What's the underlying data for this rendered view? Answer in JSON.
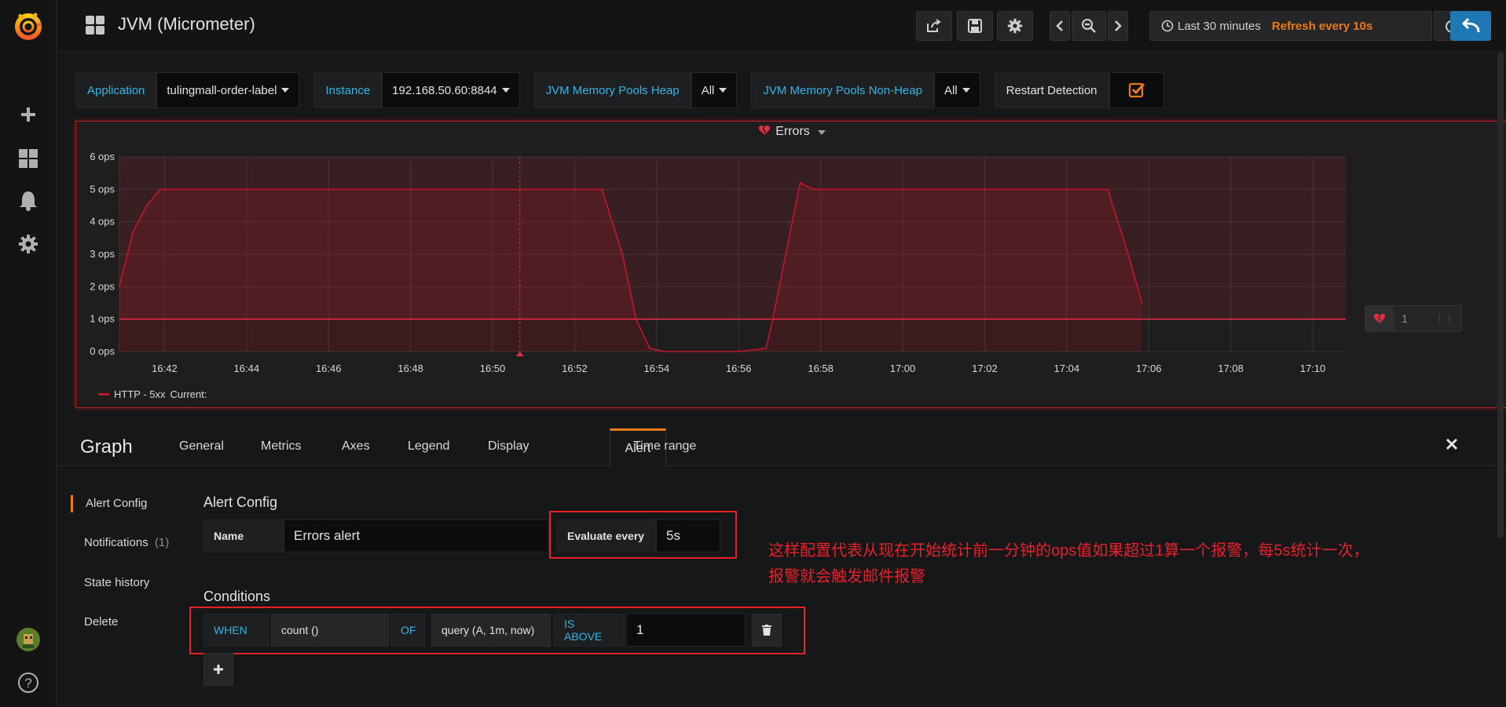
{
  "sidebar": {
    "items": [
      {
        "name": "create",
        "icon": "plus-icon"
      },
      {
        "name": "dashboards",
        "icon": "grid-icon"
      },
      {
        "name": "alerting",
        "icon": "bell-icon"
      },
      {
        "name": "configuration",
        "icon": "gear-icon"
      }
    ],
    "help_icon": "?"
  },
  "navbar": {
    "title": "JVM (Micrometer)",
    "time_range": "Last 30 minutes",
    "refresh": "Refresh every 10s"
  },
  "variables": [
    {
      "label": "Application",
      "value": "tulingmall-order-label"
    },
    {
      "label": "Instance",
      "value": "192.168.50.60:8844"
    },
    {
      "label": "JVM Memory Pools Heap",
      "value": "All"
    },
    {
      "label": "JVM Memory Pools Non-Heap",
      "value": "All"
    },
    {
      "label": "Restart Detection",
      "value": ""
    }
  ],
  "panel": {
    "title": "Errors",
    "legend_series": "HTTP - 5xx",
    "legend_current": "Current:",
    "threshold_value": "1"
  },
  "chart_data": {
    "type": "line",
    "title": "Errors",
    "y_ticks": [
      "0 ops",
      "1 ops",
      "2 ops",
      "3 ops",
      "4 ops",
      "5 ops",
      "6 ops"
    ],
    "ylim": [
      0,
      6
    ],
    "x_ticks": [
      "16:42",
      "16:44",
      "16:46",
      "16:48",
      "16:50",
      "16:52",
      "16:54",
      "16:56",
      "16:58",
      "17:00",
      "17:02",
      "17:04",
      "17:06",
      "17:08",
      "17:10"
    ],
    "series": [
      {
        "name": "HTTP - 5xx",
        "color": "#c4162a",
        "x": [
          "16:40:54",
          "16:41:14",
          "16:41:34",
          "16:41:54",
          "16:42:30",
          "16:52:40",
          "16:53:10",
          "16:53:30",
          "16:53:50",
          "16:54:10",
          "16:56:00",
          "16:56:40",
          "16:56:50",
          "16:57:30",
          "16:57:50",
          "16:58:30",
          "17:05:00",
          "17:05:30",
          "17:05:50"
        ],
        "values": [
          2.0,
          3.7,
          4.5,
          5.0,
          5.0,
          5.0,
          3.0,
          1.0,
          0.1,
          0.0,
          0.0,
          0.1,
          1.0,
          5.2,
          5.0,
          5.0,
          5.0,
          3.0,
          1.5
        ]
      }
    ],
    "threshold": {
      "value": 1,
      "op": "gt",
      "color": "#e02f44"
    },
    "annotation_time": "16:50:40",
    "grid": true,
    "legend": "bottom-left"
  },
  "editor": {
    "title": "Graph",
    "tabs": [
      "General",
      "Metrics",
      "Axes",
      "Legend",
      "Display",
      "Alert",
      "Time range"
    ],
    "active_tab": "Alert"
  },
  "alert": {
    "nav": [
      {
        "label": "Alert Config",
        "badge": ""
      },
      {
        "label": "Notifications",
        "badge": "(1)"
      },
      {
        "label": "State history",
        "badge": ""
      },
      {
        "label": "Delete",
        "badge": ""
      }
    ],
    "config_heading": "Alert Config",
    "name_label": "Name",
    "name_value": "Errors alert",
    "evaluate_label": "Evaluate every",
    "evaluate_value": "5s",
    "conditions_heading": "Conditions",
    "condition": {
      "when": "WHEN",
      "reducer": "count ()",
      "of": "OF",
      "query": "query (A, 1m, now)",
      "evaluator": "IS ABOVE",
      "threshold": "1"
    }
  },
  "annotation_note": {
    "line1": "这样配置代表从现在开始统计前一分钟的ops值如果超过1算一个报警，每5s统计一次，",
    "line2": "报警就会触发邮件报警"
  }
}
